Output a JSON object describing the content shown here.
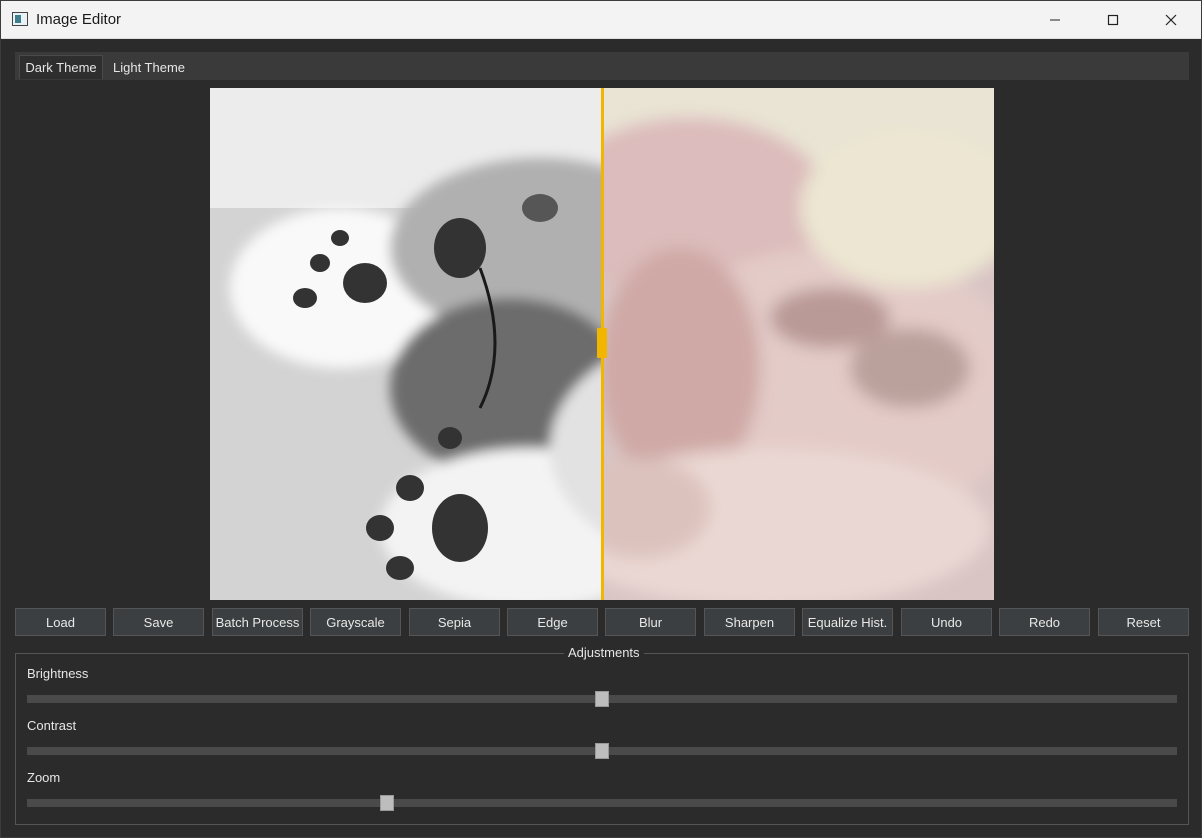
{
  "window": {
    "title": "Image Editor"
  },
  "tabs": [
    {
      "label": "Dark Theme",
      "active": true
    },
    {
      "label": "Light Theme",
      "active": false
    }
  ],
  "comparison": {
    "split_fraction": 0.5,
    "left_mode": "grayscale",
    "right_mode": "color",
    "divider_color": "#f2b600"
  },
  "toolbar": {
    "buttons": [
      {
        "label": "Load"
      },
      {
        "label": "Save"
      },
      {
        "label": "Batch Process"
      },
      {
        "label": "Grayscale"
      },
      {
        "label": "Sepia"
      },
      {
        "label": "Edge"
      },
      {
        "label": "Blur"
      },
      {
        "label": "Sharpen"
      },
      {
        "label": "Equalize Hist."
      },
      {
        "label": "Undo"
      },
      {
        "label": "Redo"
      },
      {
        "label": "Reset"
      }
    ]
  },
  "adjustments": {
    "title": "Adjustments",
    "sliders": [
      {
        "label": "Brightness",
        "value_fraction": 0.5
      },
      {
        "label": "Contrast",
        "value_fraction": 0.5
      },
      {
        "label": "Zoom",
        "value_fraction": 0.313
      }
    ]
  },
  "icons": {
    "app": "image-editor-app-icon",
    "minimize": "minimize-icon",
    "maximize": "maximize-icon",
    "close": "close-icon"
  }
}
